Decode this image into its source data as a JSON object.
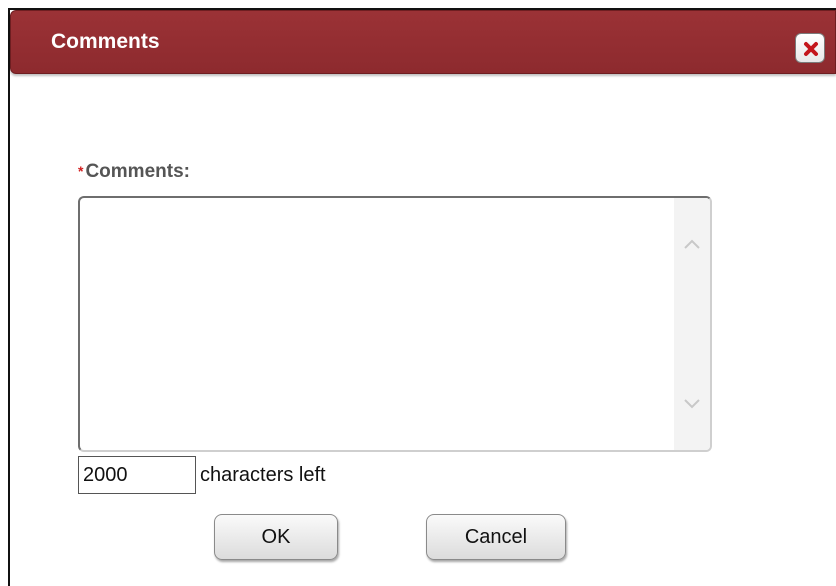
{
  "dialog": {
    "title": "Comments",
    "close_icon": "close-x-icon",
    "accent_color": "#962f33"
  },
  "form": {
    "comments_label": "Comments:",
    "required_marker": "*",
    "comments_value": "",
    "chars_left_value": "2000",
    "chars_left_text": "characters left"
  },
  "buttons": {
    "ok_label": "OK",
    "cancel_label": "Cancel"
  }
}
